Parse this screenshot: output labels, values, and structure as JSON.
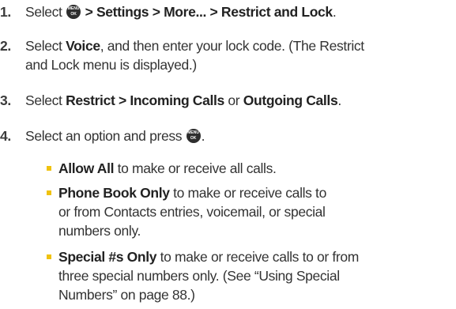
{
  "icons": {
    "menu_ok_key": "menu-ok-key-icon",
    "bullet": "yellow-square-bullet"
  },
  "colors": {
    "text": "#333333",
    "bullet": "#f0c20f",
    "key": "#2e2e2e"
  },
  "key_label": {
    "top": "MENU",
    "bottom": "OK"
  },
  "steps": [
    {
      "number": "1.",
      "pre": "Select ",
      "path": " > Settings > More... > Restrict and Lock",
      "post": "."
    },
    {
      "number": "2.",
      "pre": "Select ",
      "bold": "Voice",
      "post_line1": ", and then enter your lock code. (The Restrict",
      "line2": "and Lock menu is displayed.)"
    },
    {
      "number": "3.",
      "pre": "Select ",
      "bold1": "Restrict > Incoming Calls",
      "mid": " or ",
      "bold2": "Outgoing Calls",
      "post": "."
    },
    {
      "number": "4.",
      "pre": "Select an option and press ",
      "post": "."
    }
  ],
  "options": [
    {
      "bold": "Allow All",
      "lines": [
        " to make or receive all calls."
      ]
    },
    {
      "bold": "Phone Book Only",
      "lines": [
        " to make or receive calls to",
        "or from Contacts entries, voicemail, or special",
        "numbers only."
      ]
    },
    {
      "bold": "Special #s Only",
      "lines": [
        " to make or receive calls to or from",
        "three special numbers only. (See “Using Special",
        "Numbers” on page 88.)"
      ]
    }
  ]
}
